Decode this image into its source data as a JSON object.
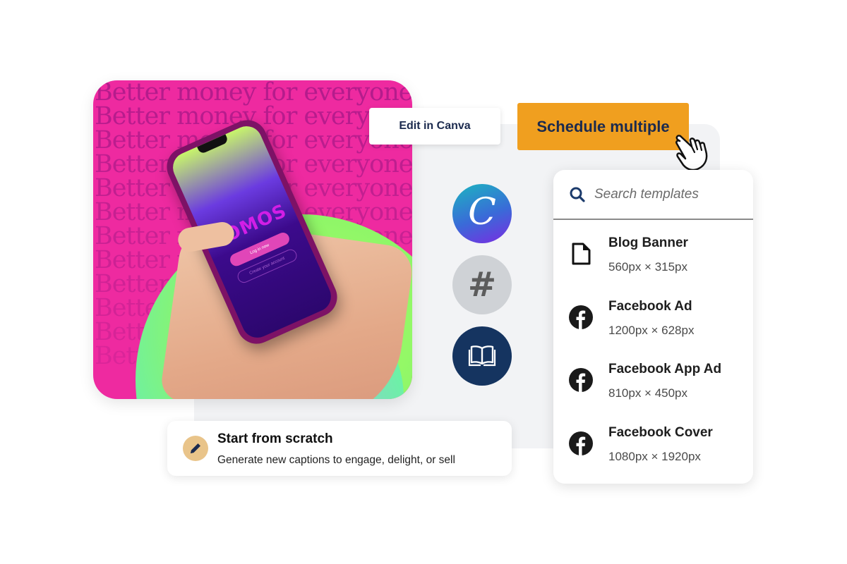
{
  "hero": {
    "repeated_line": "Better money for everyone",
    "line_count": 12,
    "phone_app_logo": "SOMOS",
    "phone_login_button": "Log in now",
    "phone_create_button": "Create your account"
  },
  "toolbar": {
    "edit_label": "Edit in Canva",
    "schedule_label": "Schedule multiple"
  },
  "colors": {
    "schedule_button": "#f09f1f",
    "button_text": "#1b2a4e",
    "hero_bg": "#ee2aa0",
    "panel_bg": "#f2f3f5",
    "book_circle": "#153460",
    "hash_circle": "#cfd2d6",
    "pen_circle": "#e9c48a"
  },
  "side_icons": [
    {
      "name": "canva-icon",
      "glyph": "C"
    },
    {
      "name": "hashtag-icon",
      "glyph": "#"
    },
    {
      "name": "book-icon",
      "glyph": ""
    }
  ],
  "templates": {
    "search_placeholder": "Search templates",
    "items": [
      {
        "icon": "document-icon",
        "name": "Blog Banner",
        "size": "560px × 315px"
      },
      {
        "icon": "facebook-icon",
        "name": "Facebook Ad",
        "size": "1200px × 628px"
      },
      {
        "icon": "facebook-icon",
        "name": "Facebook App Ad",
        "size": "810px × 450px"
      },
      {
        "icon": "facebook-icon",
        "name": "Facebook Cover",
        "size": "1080px × 1920px"
      }
    ]
  },
  "scratch": {
    "title": "Start from scratch",
    "subtitle": "Generate new captions to engage, delight, or sell"
  }
}
